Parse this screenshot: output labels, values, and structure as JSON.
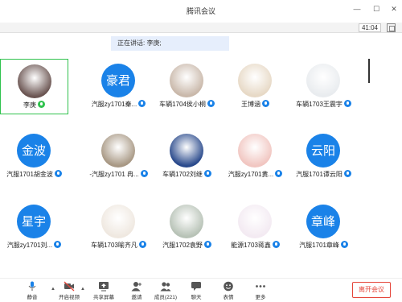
{
  "window": {
    "title": "腾讯会议",
    "time": "41:04"
  },
  "speaking": {
    "text": "正在讲话: 李庚;"
  },
  "participants": [
    {
      "name": "李庚",
      "avatar_type": "photo",
      "avatar_label": "",
      "speaking": true,
      "active": true,
      "photo_color": "#6b5552"
    },
    {
      "name": "汽服zy1701秦...",
      "avatar_type": "text",
      "avatar_label": "豪君",
      "speaking": false,
      "active": false
    },
    {
      "name": "车辆1704侯小桐",
      "avatar_type": "photo",
      "avatar_label": "",
      "speaking": false,
      "active": false,
      "photo_color": "#c9b8aa"
    },
    {
      "name": "王博涵",
      "avatar_type": "photo",
      "avatar_label": "",
      "speaking": false,
      "active": false,
      "photo_color": "#e7d9c6"
    },
    {
      "name": "车辆1703王震宇",
      "avatar_type": "photo",
      "avatar_label": "",
      "speaking": false,
      "active": false,
      "photo_color": "#e9ecef"
    },
    {
      "name": "汽服1701胡金波",
      "avatar_type": "text",
      "avatar_label": "金波",
      "speaking": false,
      "active": false
    },
    {
      "name": "-汽服zy1701 冉...",
      "avatar_type": "photo",
      "avatar_label": "",
      "speaking": false,
      "active": false,
      "photo_color": "#a89884"
    },
    {
      "name": "车辆1702刘继",
      "avatar_type": "photo",
      "avatar_label": "",
      "speaking": false,
      "active": false,
      "photo_color": "#2a4a8c"
    },
    {
      "name": "汽服zy1701黄...",
      "avatar_type": "photo",
      "avatar_label": "",
      "speaking": false,
      "active": false,
      "photo_color": "#f1c6c1"
    },
    {
      "name": "汽服1701谭云阳",
      "avatar_type": "text",
      "avatar_label": "云阳",
      "speaking": false,
      "active": false
    },
    {
      "name": "汽服zy1701刘...",
      "avatar_type": "text",
      "avatar_label": "星宇",
      "speaking": false,
      "active": false
    },
    {
      "name": "车辆1703喻齐凡",
      "avatar_type": "photo",
      "avatar_label": "",
      "speaking": false,
      "active": false,
      "photo_color": "#efe8e0"
    },
    {
      "name": "汽服1702袁野",
      "avatar_type": "photo",
      "avatar_label": "",
      "speaking": false,
      "active": false,
      "photo_color": "#b7c2b6"
    },
    {
      "name": "能源1703蒋鑫",
      "avatar_type": "photo",
      "avatar_label": "",
      "speaking": false,
      "active": false,
      "photo_color": "#f3eaf2"
    },
    {
      "name": "汽服1701章峰",
      "avatar_type": "text",
      "avatar_label": "章峰",
      "speaking": false,
      "active": false
    }
  ],
  "toolbar": {
    "mute": "静音",
    "video": "开启视频",
    "share": "共享屏幕",
    "invite": "邀请",
    "members": "成员(221)",
    "chat": "聊天",
    "reactions": "表情",
    "more": "更多",
    "leave": "离开会议"
  },
  "colors": {
    "accent": "#1a82e8",
    "speaking": "#2fc24d",
    "leave": "#e5453a"
  }
}
